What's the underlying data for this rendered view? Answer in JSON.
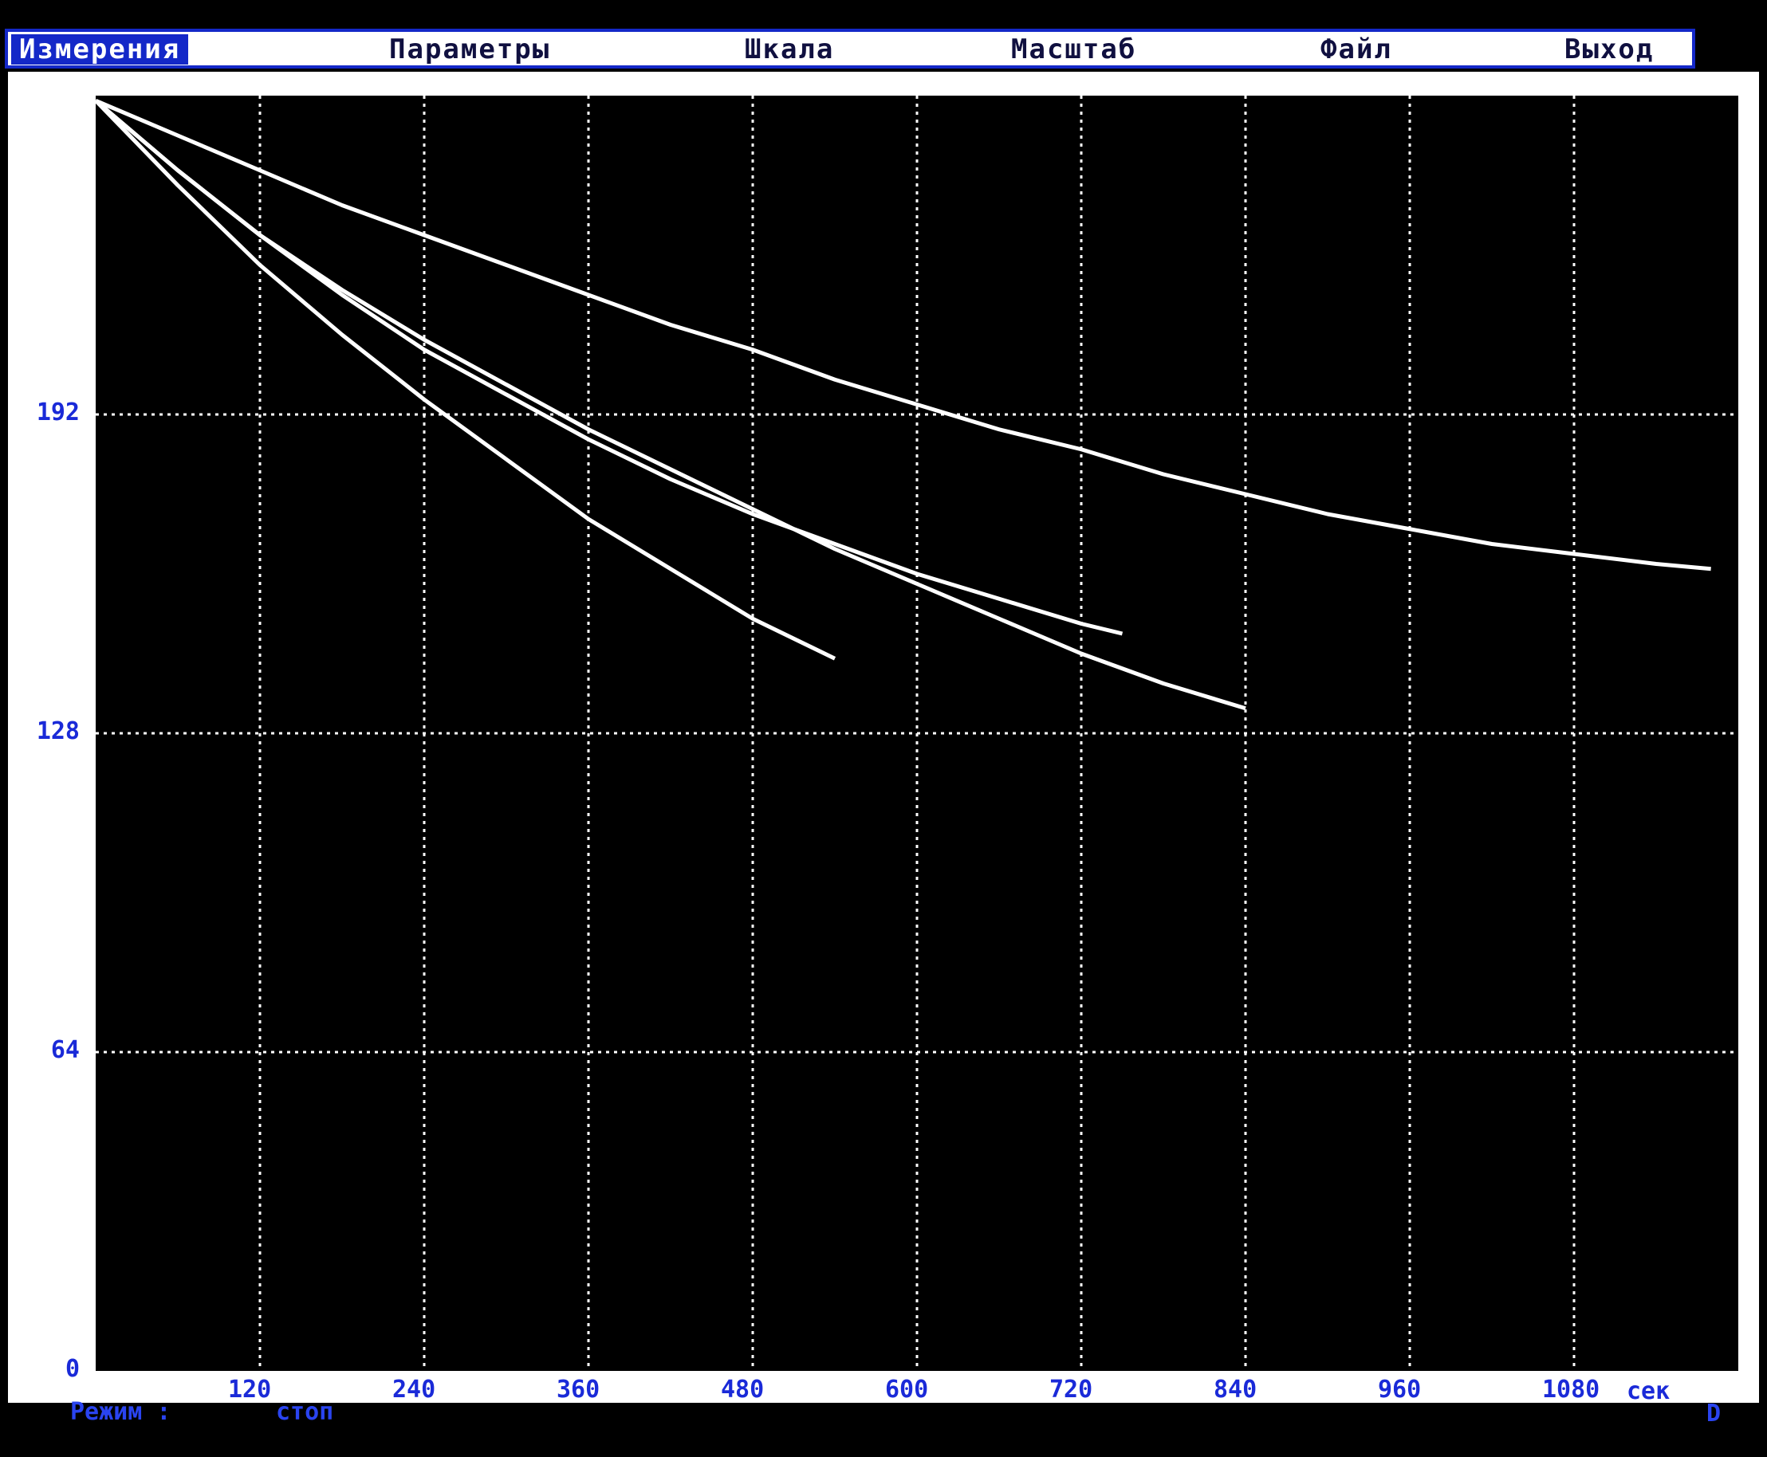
{
  "menu": {
    "items": [
      {
        "label": "Измерения",
        "active": true
      },
      {
        "label": "Параметры",
        "active": false
      },
      {
        "label": "Шкала",
        "active": false
      },
      {
        "label": "Масштаб",
        "active": false
      },
      {
        "label": "Файл",
        "active": false
      },
      {
        "label": "Выход",
        "active": false
      }
    ]
  },
  "status": {
    "mode_label": "Режим :",
    "mode_value": "стоп",
    "right_indicator": "D"
  },
  "colors": {
    "menu_highlight": "#1428c8",
    "axis_label": "#1a2ad8",
    "background": "#000000",
    "trace": "#ffffff"
  },
  "chart_data": {
    "type": "line",
    "xlabel": "сек",
    "ylabel": "",
    "xlim": [
      0,
      1200
    ],
    "ylim": [
      0,
      256
    ],
    "xticks": [
      "120",
      "240",
      "360",
      "480",
      "600",
      "720",
      "840",
      "960",
      "1080"
    ],
    "yticks": [
      "0",
      "64",
      "128",
      "192"
    ],
    "grid": true,
    "series": [
      {
        "x": [
          0,
          60,
          120,
          180,
          240,
          300,
          360,
          420,
          480,
          540
        ],
        "y": [
          255,
          238,
          222,
          208,
          195,
          183,
          171,
          161,
          151,
          143
        ]
      },
      {
        "x": [
          0,
          60,
          120,
          180,
          240,
          300,
          360,
          420,
          480,
          540,
          600,
          660,
          720,
          780,
          840
        ],
        "y": [
          255,
          241,
          228,
          217,
          207,
          198,
          189,
          181,
          173,
          165,
          158,
          151,
          144,
          138,
          133
        ]
      },
      {
        "x": [
          0,
          60,
          120,
          180,
          240,
          300,
          360,
          420,
          480,
          540,
          600,
          660,
          720,
          750
        ],
        "y": [
          255,
          241,
          228,
          216,
          205,
          196,
          187,
          179,
          172,
          166,
          160,
          155,
          150,
          148
        ]
      },
      {
        "x": [
          0,
          60,
          120,
          180,
          240,
          300,
          360,
          420,
          480,
          540,
          600,
          660,
          720,
          780,
          840,
          900,
          960,
          1020,
          1080,
          1140,
          1180
        ],
        "y": [
          255,
          248,
          241,
          234,
          228,
          222,
          216,
          210,
          205,
          199,
          194,
          189,
          185,
          180,
          176,
          172,
          169,
          166,
          164,
          162,
          161
        ]
      }
    ]
  }
}
